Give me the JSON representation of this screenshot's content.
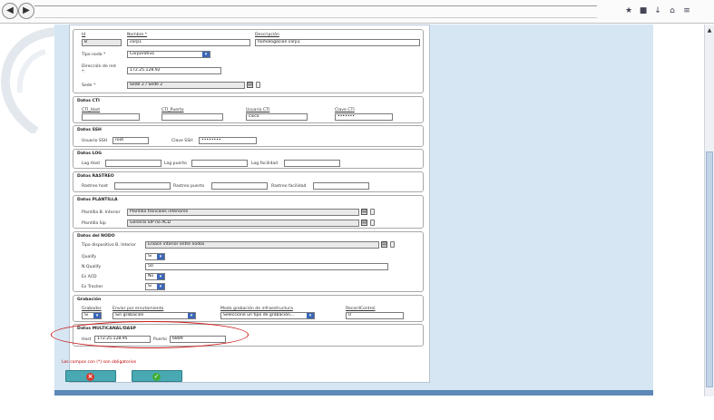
{
  "browser": {
    "back_label": "◀",
    "forward_label": "▶",
    "url_value": ""
  },
  "form": {
    "general": {
      "id_label": "Id",
      "id_value": "8",
      "nombre_label": "Nombre *",
      "nombre_value": "corp1",
      "descripcion_label": "Descripción",
      "descripcion_value": "homologacion corp1",
      "tipo_nodo_label": "Tipo nodo *",
      "tipo_nodo_value": "Corporativo",
      "direccion_label_1": "Dirección de red",
      "direccion_label_2": "*:",
      "direccion_value": "172.25.128.92",
      "sede_label": "Sede *",
      "sede_value": "Sede 2 / Sede 2"
    },
    "cti": {
      "legend": "Datos CTI",
      "host_label": "CTI_Host",
      "host_value": "",
      "puerto_label": "CTI_Puerto",
      "puerto_value": "",
      "usuario_label": "Usuario CTI",
      "usuario_value": "cisco",
      "clave_label": "Clave CTI",
      "clave_value": "•••••••"
    },
    "ssh": {
      "legend": "Datos SSH",
      "usuario_label": "Usuario SSH",
      "usuario_value": "root",
      "clave_label": "Clave SSH",
      "clave_value": "••••••••"
    },
    "log": {
      "legend": "Datos LOG",
      "host_label": "Log Host",
      "host_value": "",
      "puerto_label": "Log puerto",
      "puerto_value": "",
      "facilidad_label": "Log facilidad",
      "facilidad_value": ""
    },
    "rastreo": {
      "legend": "Datos RASTREO",
      "host_label": "Rastreo host",
      "host_value": "",
      "puerto_label": "Rastreo puerto",
      "puerto_value": "",
      "facilidad_label": "Rastreo facilidad",
      "facilidad_value": ""
    },
    "plantilla": {
      "legend": "Datos PLANTILLA",
      "interior_label": "Plantilla B. Interior",
      "interior_value": "Plantilla troncales interiores",
      "sip_label": "Plantilla Sip",
      "sip_value": "General SIP no ACD"
    },
    "nodo": {
      "legend": "Datos del NODO",
      "tipo_label": "Tipo dispositivo B. Interior",
      "tipo_value": "Enlace interior entre nodos",
      "qsig_label": "Qualify",
      "qsig_value": "Si",
      "nqualify_label": "N.Qualify",
      "nqualify_value": "50",
      "acd_label": "Es ACD",
      "acd_value": "No",
      "tracker_label": "Es Tracker",
      "tracker_value": "Si"
    },
    "grabacion": {
      "legend": "Grabación",
      "grabador_label": "Grabador",
      "grabador_value": "Si",
      "enviar_label": "Enviar por enrutamiento",
      "enviar_value": "Sin grabación",
      "modo_label": "Modo grabación de infraestructura",
      "modo_value": "Seleccione un tipo de grabación...",
      "record_label": "RecordControl",
      "record_value": "0"
    },
    "multicanal": {
      "legend": "Datos MULTICANAL/DASP",
      "host_label": "Host",
      "host_value": "172.25.128.95",
      "puerto_label": "Puerto",
      "puerto_value": "6889"
    },
    "required_note": "Los campos con (*) son obligatorios"
  },
  "colors": {
    "page_bg": "#d6e6f3",
    "button": "#48a9b2",
    "annotation": "#cc1a1a",
    "dropdown": "#3a66b8"
  }
}
